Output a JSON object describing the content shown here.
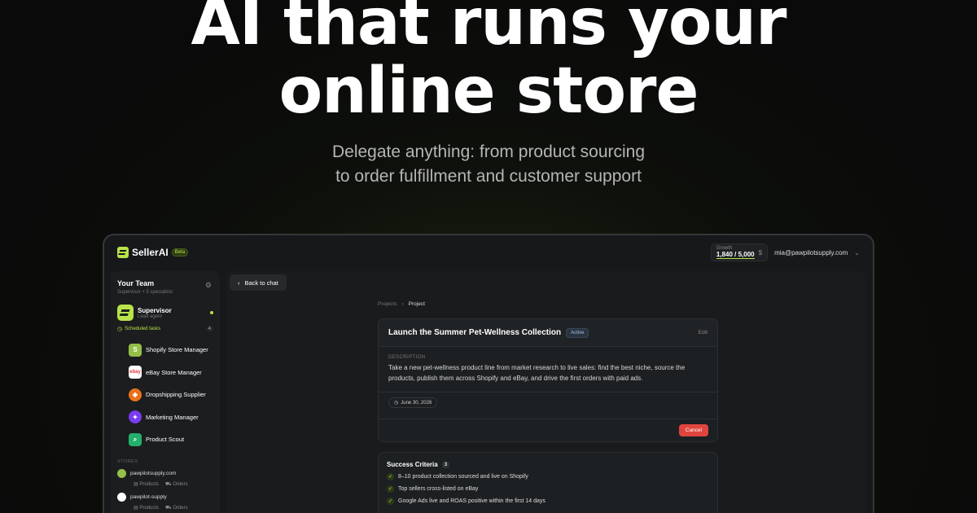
{
  "hero": {
    "title_line1": "AI that runs your",
    "title_line2": "online store",
    "subtitle_line1": "Delegate anything: from product sourcing",
    "subtitle_line2": "to order fulfillment and customer support"
  },
  "app": {
    "brand": "SellerAI",
    "beta": "Beta",
    "growth_label": "Growth",
    "growth_value": "1,840 / 5,000",
    "currency_symbol": "$",
    "user_email": "mia@pawpilotsupply.com",
    "accent_color": "#b8e34a"
  },
  "sidebar": {
    "team_title": "Your Team",
    "team_sub": "Supervisor + 5 specialists",
    "supervisor_name": "Supervisor",
    "supervisor_role": "Lead agent",
    "scheduled_label": "Scheduled tasks",
    "scheduled_count": "4",
    "agents": [
      {
        "label": "Shopify Store Manager",
        "icon": "shopify-icon",
        "glyph": "S",
        "color": "#95bf47"
      },
      {
        "label": "eBay Store Manager",
        "icon": "ebay-icon",
        "glyph": "e",
        "color": "#ffffff"
      },
      {
        "label": "Dropshipping Supplier",
        "icon": "box-icon",
        "glyph": "◈",
        "color": "#e8711c"
      },
      {
        "label": "Marketing Manager",
        "icon": "megaphone-icon",
        "glyph": "✦",
        "color": "#7a3cf0"
      },
      {
        "label": "Product Scout",
        "icon": "search-icon",
        "glyph": "⌕",
        "color": "#22b06a"
      }
    ],
    "stores_label": "STORES",
    "stores": [
      {
        "name": "pawpilotsupply.com",
        "products": "Products",
        "orders": "Orders"
      },
      {
        "name": "pawpilot-supply",
        "products": "Products",
        "orders": "Orders"
      }
    ]
  },
  "main": {
    "back_label": "Back to chat",
    "breadcrumb": [
      "Projects",
      "Project"
    ],
    "project": {
      "title": "Launch the Summer Pet-Wellness Collection",
      "status": "Active",
      "edit": "Edit",
      "desc_label": "DESCRIPTION",
      "description": "Take a new pet-wellness product line from market research to live sales: find the best niche, source the products, publish them across Shopify and eBay, and drive the first orders with paid ads.",
      "date": "June 30, 2026",
      "cancel": "Cancel"
    },
    "criteria": {
      "title": "Success Criteria",
      "count": "3",
      "items": [
        "8–10 product collection sourced and live on Shopify",
        "Top sellers cross-listed on eBay",
        "Google Ads live and ROAS positive within the first 14 days"
      ]
    }
  }
}
